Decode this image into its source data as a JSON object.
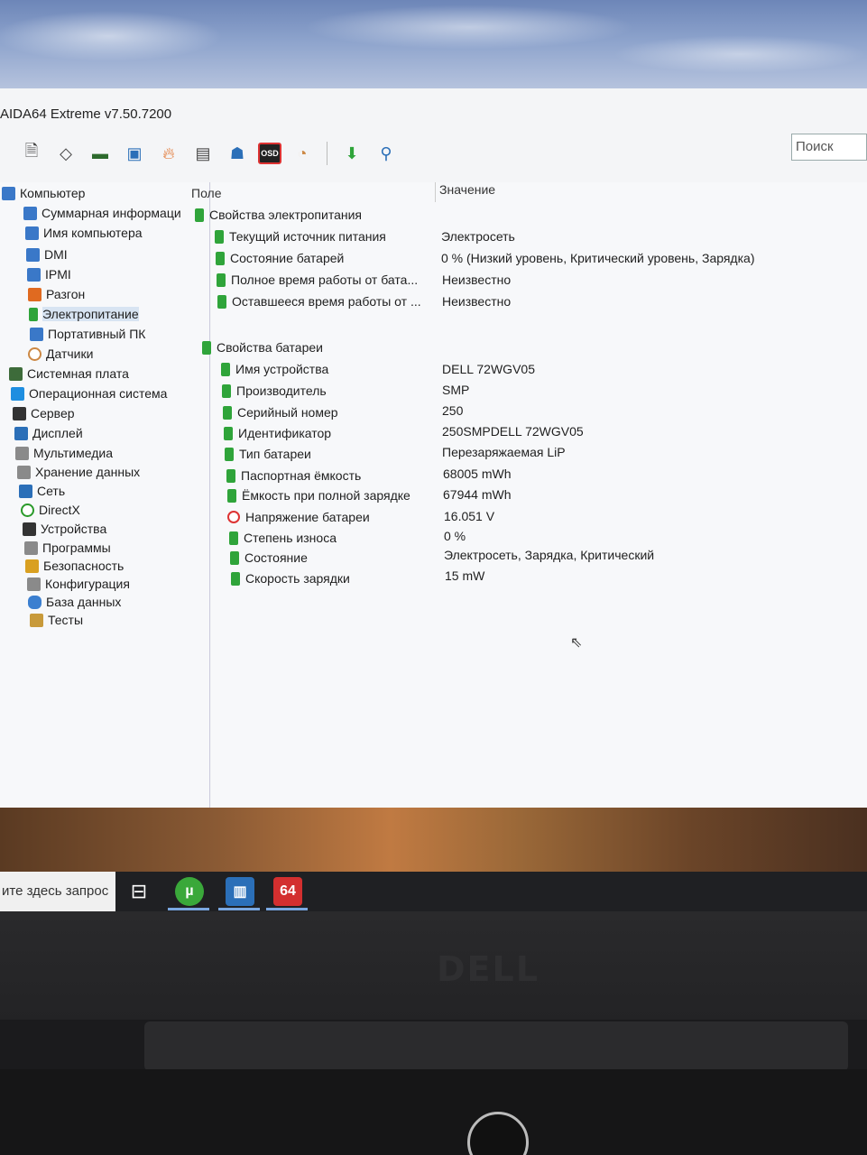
{
  "app": {
    "title": "AIDA64 Extreme v7.50.7200",
    "search_placeholder": "Поиск"
  },
  "toolbar": {
    "icons": [
      "report-icon",
      "motherboard-icon",
      "memory-icon",
      "network-icon",
      "flame-icon",
      "clipboard-icon",
      "user-icon",
      "osd-icon",
      "gauge-icon",
      "download-icon",
      "search-icon"
    ],
    "osd_label": "OSD"
  },
  "sidebar": {
    "items": [
      {
        "label": "Компьютер",
        "icon": "computer-icon"
      },
      {
        "label": "Суммарная информаци",
        "icon": "computer-icon"
      },
      {
        "label": "Имя компьютера",
        "icon": "computer-icon"
      },
      {
        "label": "DMI",
        "icon": "computer-icon"
      },
      {
        "label": "IPMI",
        "icon": "computer-icon"
      },
      {
        "label": "Разгон",
        "icon": "flame-icon"
      },
      {
        "label": "Электропитание",
        "icon": "battery-icon"
      },
      {
        "label": "Портативный ПК",
        "icon": "computer-icon"
      },
      {
        "label": "Датчики",
        "icon": "sensor-icon"
      },
      {
        "label": "Системная плата",
        "icon": "motherboard-icon"
      },
      {
        "label": "Операционная система",
        "icon": "windows-icon"
      },
      {
        "label": "Сервер",
        "icon": "server-icon"
      },
      {
        "label": "Дисплей",
        "icon": "display-icon"
      },
      {
        "label": "Мультимедиа",
        "icon": "multimedia-icon"
      },
      {
        "label": "Хранение данных",
        "icon": "storage-icon"
      },
      {
        "label": "Сеть",
        "icon": "network-icon"
      },
      {
        "label": "DirectX",
        "icon": "xbox-icon"
      },
      {
        "label": "Устройства",
        "icon": "devices-icon"
      },
      {
        "label": "Программы",
        "icon": "programs-icon"
      },
      {
        "label": "Безопасность",
        "icon": "shield-icon"
      },
      {
        "label": "Конфигурация",
        "icon": "config-icon"
      },
      {
        "label": "База данных",
        "icon": "database-icon"
      },
      {
        "label": "Тесты",
        "icon": "tests-icon"
      }
    ]
  },
  "table": {
    "col_field": "Поле",
    "col_value": "Значение",
    "groups": [
      {
        "title": "Свойства электропитания",
        "rows": [
          {
            "field": "Текущий источник питания",
            "value": "Электросеть"
          },
          {
            "field": "Состояние батарей",
            "value": "0 % (Низкий уровень, Критический уровень, Зарядка)"
          },
          {
            "field": "Полное время работы от бата...",
            "value": "Неизвестно"
          },
          {
            "field": "Оставшееся время работы от ...",
            "value": "Неизвестно"
          }
        ]
      },
      {
        "title": "Свойства батареи",
        "rows": [
          {
            "field": "Имя устройства",
            "value": "DELL 72WGV05"
          },
          {
            "field": "Производитель",
            "value": "SMP"
          },
          {
            "field": "Серийный номер",
            "value": "250"
          },
          {
            "field": "Идентификатор",
            "value": "250SMPDELL 72WGV05"
          },
          {
            "field": "Тип батареи",
            "value": "Перезаряжаемая LiP"
          },
          {
            "field": "Паспортная ёмкость",
            "value": "68005 mWh"
          },
          {
            "field": "Ёмкость при полной зарядке",
            "value": "67944 mWh"
          },
          {
            "field": "Напряжение батареи",
            "value": "16.051 V"
          },
          {
            "field": "Степень износа",
            "value": "0 %"
          },
          {
            "field": "Состояние",
            "value": "Электросеть, Зарядка, Критический"
          },
          {
            "field": "Скорость зарядки",
            "value": "15 mW"
          }
        ]
      }
    ]
  },
  "taskbar": {
    "search_text": "ите здесь запрос",
    "aida_label": "64"
  },
  "bezel": {
    "logo": "DELL"
  }
}
